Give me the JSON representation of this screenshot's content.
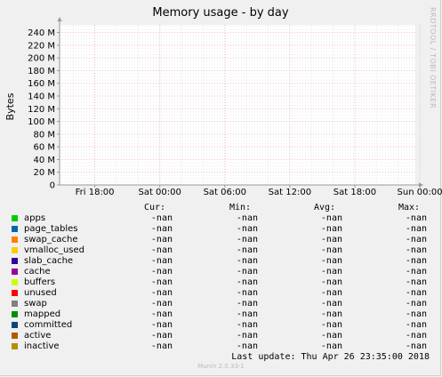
{
  "title": "Memory usage - by day",
  "watermark": "RRDTOOL / TOBI OETIKER",
  "chart_data": {
    "type": "area",
    "ylabel": "Bytes",
    "ylim": [
      0,
      252
    ],
    "yunit": "M",
    "yticks": [
      {
        "label": "0",
        "value": 0
      },
      {
        "label": "20 M",
        "value": 20
      },
      {
        "label": "40 M",
        "value": 40
      },
      {
        "label": "60 M",
        "value": 60
      },
      {
        "label": "80 M",
        "value": 80
      },
      {
        "label": "100 M",
        "value": 100
      },
      {
        "label": "120 M",
        "value": 120
      },
      {
        "label": "140 M",
        "value": 140
      },
      {
        "label": "160 M",
        "value": 160
      },
      {
        "label": "180 M",
        "value": 180
      },
      {
        "label": "200 M",
        "value": 200
      },
      {
        "label": "220 M",
        "value": 220
      },
      {
        "label": "240 M",
        "value": 240
      }
    ],
    "xlim": [
      "Fri 14:45",
      "Sat 23:35"
    ],
    "xticks": [
      {
        "label": "Fri 18:00",
        "hours": 18
      },
      {
        "label": "Sat 00:00",
        "hours": 24
      },
      {
        "label": "Sat 06:00",
        "hours": 30
      },
      {
        "label": "Sat 12:00",
        "hours": 36
      },
      {
        "label": "Sat 18:00",
        "hours": 42
      },
      {
        "label": "Sun 00:00",
        "hours": 48
      }
    ],
    "grid": true,
    "series": []
  },
  "legend": {
    "headers": {
      "cur": "Cur:",
      "min": "Min:",
      "avg": "Avg:",
      "max": "Max:"
    },
    "items": [
      {
        "name": "apps",
        "color": "#00cc00",
        "cur": "-nan",
        "min": "-nan",
        "avg": "-nan",
        "max": "-nan"
      },
      {
        "name": "page_tables",
        "color": "#0066b3",
        "cur": "-nan",
        "min": "-nan",
        "avg": "-nan",
        "max": "-nan"
      },
      {
        "name": "swap_cache",
        "color": "#ff8000",
        "cur": "-nan",
        "min": "-nan",
        "avg": "-nan",
        "max": "-nan"
      },
      {
        "name": "vmalloc_used",
        "color": "#ffcc00",
        "cur": "-nan",
        "min": "-nan",
        "avg": "-nan",
        "max": "-nan"
      },
      {
        "name": "slab_cache",
        "color": "#330099",
        "cur": "-nan",
        "min": "-nan",
        "avg": "-nan",
        "max": "-nan"
      },
      {
        "name": "cache",
        "color": "#990099",
        "cur": "-nan",
        "min": "-nan",
        "avg": "-nan",
        "max": "-nan"
      },
      {
        "name": "buffers",
        "color": "#ccff00",
        "cur": "-nan",
        "min": "-nan",
        "avg": "-nan",
        "max": "-nan"
      },
      {
        "name": "unused",
        "color": "#ff0000",
        "cur": "-nan",
        "min": "-nan",
        "avg": "-nan",
        "max": "-nan"
      },
      {
        "name": "swap",
        "color": "#808080",
        "cur": "-nan",
        "min": "-nan",
        "avg": "-nan",
        "max": "-nan"
      },
      {
        "name": "mapped",
        "color": "#008f00",
        "cur": "-nan",
        "min": "-nan",
        "avg": "-nan",
        "max": "-nan"
      },
      {
        "name": "committed",
        "color": "#00487d",
        "cur": "-nan",
        "min": "-nan",
        "avg": "-nan",
        "max": "-nan"
      },
      {
        "name": "active",
        "color": "#b35a00",
        "cur": "-nan",
        "min": "-nan",
        "avg": "-nan",
        "max": "-nan"
      },
      {
        "name": "inactive",
        "color": "#b38f00",
        "cur": "-nan",
        "min": "-nan",
        "avg": "-nan",
        "max": "-nan"
      }
    ]
  },
  "last_update": "Last update:  Thu Apr 26 23:35:00 2018",
  "version": "Munin 2.0.33-1"
}
